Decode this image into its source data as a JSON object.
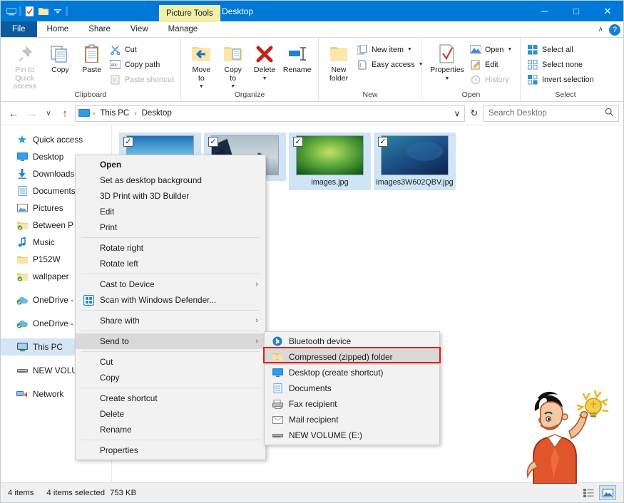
{
  "window": {
    "title": "Desktop",
    "context_tab": "Picture Tools",
    "quick_access_icons": [
      "explorer-icon",
      "properties-icon",
      "new-folder-icon",
      "customize-caret-icon"
    ],
    "minimize": "─",
    "maximize": "□",
    "close": "✕",
    "collapse_ribbon": "∧",
    "help": "?"
  },
  "tabs": [
    {
      "label": "File",
      "id": "file"
    },
    {
      "label": "Home",
      "id": "home"
    },
    {
      "label": "Share",
      "id": "share"
    },
    {
      "label": "View",
      "id": "view"
    },
    {
      "label": "Manage",
      "id": "manage"
    }
  ],
  "ribbon": {
    "groups": [
      {
        "label": "Clipboard",
        "big": [
          {
            "label": "Pin to Quick\naccess",
            "icon": "pin-icon",
            "disabled": true
          },
          {
            "label": "Copy",
            "icon": "copy-icon",
            "disabled": false
          },
          {
            "label": "Paste",
            "icon": "paste-icon",
            "disabled": false
          }
        ],
        "small": [
          {
            "label": "Cut",
            "icon": "scissors-icon",
            "disabled": false
          },
          {
            "label": "Copy path",
            "icon": "copy-path-icon",
            "disabled": false
          },
          {
            "label": "Paste shortcut",
            "icon": "paste-shortcut-icon",
            "disabled": true
          }
        ]
      },
      {
        "label": "Organize",
        "big": [
          {
            "label": "Move\nto",
            "icon": "move-to-icon",
            "caret": true
          },
          {
            "label": "Copy\nto",
            "icon": "copy-to-icon",
            "caret": true
          },
          {
            "label": "Delete",
            "icon": "delete-icon",
            "caret": true
          },
          {
            "label": "Rename",
            "icon": "rename-icon",
            "caret": false
          }
        ],
        "small": []
      },
      {
        "label": "New",
        "big": [
          {
            "label": "New\nfolder",
            "icon": "new-folder-icon",
            "caret": false
          }
        ],
        "small": [
          {
            "label": "New item",
            "icon": "new-item-icon",
            "caret": true
          },
          {
            "label": "Easy access",
            "icon": "easy-access-icon",
            "caret": true
          }
        ]
      },
      {
        "label": "Open",
        "big": [
          {
            "label": "Properties",
            "icon": "properties-icon",
            "caret": true
          }
        ],
        "small": [
          {
            "label": "Open",
            "icon": "open-icon",
            "caret": true
          },
          {
            "label": "Edit",
            "icon": "edit-icon",
            "caret": false
          },
          {
            "label": "History",
            "icon": "history-icon",
            "disabled": true
          }
        ]
      },
      {
        "label": "Select",
        "big": [],
        "small": [
          {
            "label": "Select all",
            "icon": "select-all-icon"
          },
          {
            "label": "Select none",
            "icon": "select-none-icon"
          },
          {
            "label": "Invert selection",
            "icon": "invert-selection-icon"
          }
        ]
      }
    ]
  },
  "addressbar": {
    "back": "←",
    "forward": "→",
    "recent": "∨",
    "up": "↑",
    "breadcrumbs": [
      "This PC",
      "Desktop"
    ],
    "dropdown": "∨",
    "refresh": "↻",
    "search_placeholder": "Search Desktop",
    "search_value": "",
    "search_icon": "search-icon"
  },
  "navpane": {
    "items": [
      {
        "label": "Quick access",
        "icon": "star-icon",
        "selected": false,
        "gap": false
      },
      {
        "label": "Desktop",
        "icon": "desktop-icon",
        "selected": false,
        "gap": false
      },
      {
        "label": "Downloads",
        "icon": "downloads-icon",
        "selected": false,
        "gap": false
      },
      {
        "label": "Documents",
        "icon": "documents-icon",
        "selected": false,
        "gap": false
      },
      {
        "label": "Pictures",
        "icon": "pictures-icon",
        "selected": false,
        "gap": false
      },
      {
        "label": "Between P",
        "icon": "synced-folder-icon",
        "selected": false,
        "gap": false
      },
      {
        "label": "Music",
        "icon": "music-icon",
        "selected": false,
        "gap": false
      },
      {
        "label": "P152W",
        "icon": "folder-icon",
        "selected": false,
        "gap": false
      },
      {
        "label": "wallpaper",
        "icon": "synced-folder-icon",
        "selected": false,
        "gap": false
      },
      {
        "label": "OneDrive -",
        "icon": "onedrive-icon",
        "selected": false,
        "gap": true
      },
      {
        "label": "OneDrive -",
        "icon": "onedrive-icon",
        "selected": false,
        "gap": true
      },
      {
        "label": "This PC",
        "icon": "thispc-icon",
        "selected": true,
        "gap": true
      },
      {
        "label": "NEW VOLU",
        "icon": "drive-icon",
        "selected": false,
        "gap": true
      },
      {
        "label": "Network",
        "icon": "network-icon",
        "selected": false,
        "gap": true
      }
    ]
  },
  "files": [
    {
      "name": "",
      "checked": true,
      "thumb": "sunset-gradient"
    },
    {
      "name": "",
      "checked": true,
      "thumb": "mountain-fog"
    },
    {
      "name": "images.jpg",
      "checked": true,
      "thumb": "green-radial"
    },
    {
      "name": "images3W602QBV.jpg",
      "checked": true,
      "thumb": "blue-dark"
    }
  ],
  "contextmenu": {
    "items": [
      {
        "label": "Open",
        "bold": true,
        "sep_after": false
      },
      {
        "label": "Set as desktop background",
        "sep_after": false
      },
      {
        "label": "3D Print with 3D Builder",
        "sep_after": false
      },
      {
        "label": "Edit",
        "sep_after": false
      },
      {
        "label": "Print",
        "sep_after": true
      },
      {
        "label": "Rotate right",
        "sep_after": false
      },
      {
        "label": "Rotate left",
        "sep_after": true
      },
      {
        "label": "Cast to Device",
        "arrow": true,
        "sep_after": false
      },
      {
        "label": "Scan with Windows Defender...",
        "icon": "defender-icon",
        "sep_after": true
      },
      {
        "label": "Share with",
        "arrow": true,
        "sep_after": true
      },
      {
        "label": "Send to",
        "arrow": true,
        "highlighted": true,
        "sep_after": true
      },
      {
        "label": "Cut",
        "sep_after": false
      },
      {
        "label": "Copy",
        "sep_after": true
      },
      {
        "label": "Create shortcut",
        "sep_after": false
      },
      {
        "label": "Delete",
        "sep_after": false
      },
      {
        "label": "Rename",
        "sep_after": true
      },
      {
        "label": "Properties",
        "sep_after": false
      }
    ]
  },
  "submenu": {
    "items": [
      {
        "label": "Bluetooth device",
        "icon": "bluetooth-icon",
        "highlighted": false
      },
      {
        "label": "Compressed (zipped) folder",
        "icon": "zip-folder-icon",
        "highlighted": true
      },
      {
        "label": "Desktop (create shortcut)",
        "icon": "desktop-icon",
        "highlighted": false
      },
      {
        "label": "Documents",
        "icon": "documents-icon",
        "highlighted": false
      },
      {
        "label": "Fax recipient",
        "icon": "fax-icon",
        "highlighted": false
      },
      {
        "label": "Mail recipient",
        "icon": "mail-icon",
        "highlighted": false
      },
      {
        "label": "NEW VOLUME (E:)",
        "icon": "drive-icon",
        "highlighted": false
      }
    ],
    "highlight_color": "#e01b1b"
  },
  "statusbar": {
    "item_count": "4 items",
    "selection": "4 items selected",
    "size": "753 KB",
    "views": [
      {
        "name": "details-view-icon",
        "active": false
      },
      {
        "name": "large-icons-view-icon",
        "active": true
      }
    ]
  },
  "colors": {
    "titlebar": "#0078d7",
    "context_tab": "#f2f0a8",
    "selection": "#cfe4f7",
    "nav_selected": "#d6e5f5",
    "highlight_red": "#e01b1b"
  }
}
